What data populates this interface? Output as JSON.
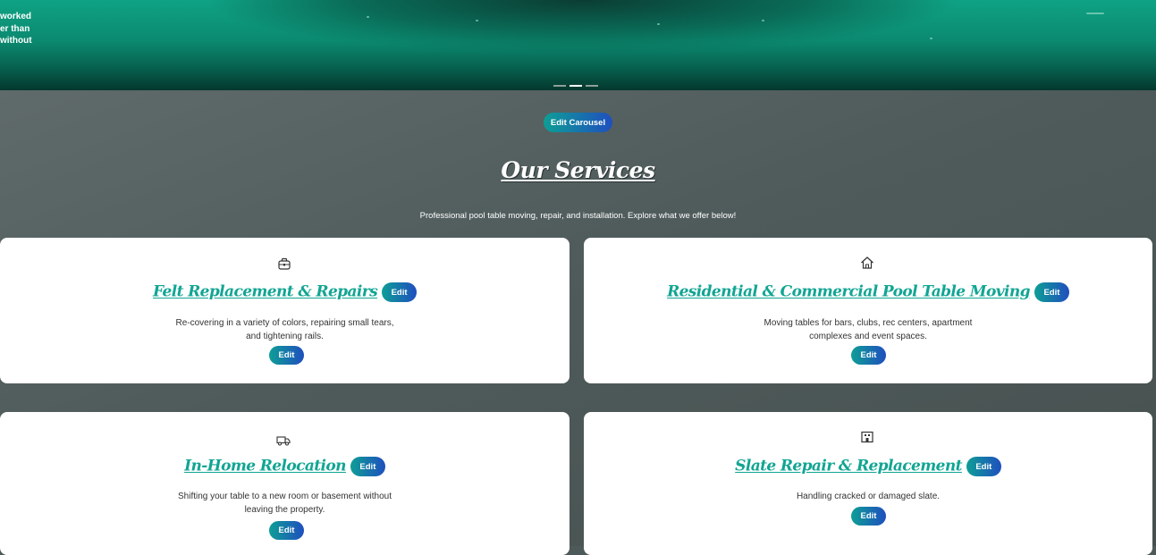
{
  "hero": {
    "text_lines": [
      "worked",
      "er than",
      "without"
    ],
    "carousel_dots": [
      false,
      true,
      false
    ]
  },
  "edit_carousel_label": "Edit Carousel",
  "services": {
    "title": "Our Services",
    "subtitle": "Professional pool table moving, repair, and installation. Explore what we offer below!",
    "cards": [
      {
        "icon": "toolbox-icon",
        "title": "Felt Replacement & Repairs",
        "title_edit_label": "Edit",
        "desc_lines": [
          "Re-covering in a variety of colors, repairing small tears,",
          "and tightening rails."
        ],
        "edit_label": "Edit"
      },
      {
        "icon": "house-icon",
        "title": "Residential & Commercial Pool Table Moving",
        "title_edit_label": "Edit",
        "desc_lines": [
          "Moving tables for bars, clubs, rec centers, apartment",
          "complexes and event spaces."
        ],
        "edit_label": "Edit"
      },
      {
        "icon": "truck-icon",
        "title": "In-Home Relocation",
        "title_edit_label": "Edit",
        "desc_lines": [
          "Shifting your table to a new room or basement without",
          "leaving the property."
        ],
        "edit_label": "Edit"
      },
      {
        "icon": "building-icon",
        "title": "Slate Repair & Replacement",
        "title_edit_label": "Edit",
        "desc_lines": [
          "Handling cracked or damaged slate."
        ],
        "edit_label": "Edit"
      }
    ]
  },
  "colors": {
    "accent": "#11a593",
    "button_gradient_start": "#0e9e96",
    "button_gradient_end": "#1f4fbf"
  }
}
